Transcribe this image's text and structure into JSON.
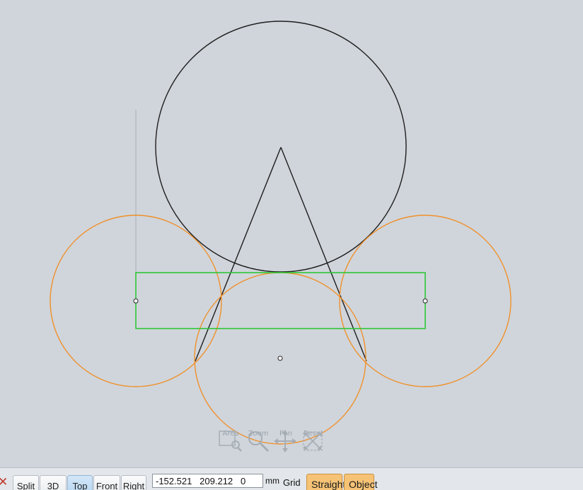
{
  "nav_tools": [
    {
      "label": "Area",
      "icon": "area-zoom-icon"
    },
    {
      "label": "Zoom",
      "icon": "zoom-icon"
    },
    {
      "label": "Pan",
      "icon": "pan-icon"
    },
    {
      "label": "Reset",
      "icon": "reset-view-icon"
    }
  ],
  "toolbar": {
    "close_glyph": "✕",
    "views": [
      "Split",
      "3D",
      "Top",
      "Front",
      "Right"
    ],
    "active_view": "Top",
    "coordinates": "-152.521   209.212   0",
    "unit": "mm",
    "grid_label": "Grid",
    "straight_label": "Straight",
    "object_label": "Object"
  },
  "colors": {
    "background": "#d0d5db",
    "sketch_line": "#1e1e1e",
    "selected_circle": "#f0902a",
    "selected_rect": "#2ec838",
    "construction_line": "#a9afb6",
    "mode_button": "#f6c376"
  }
}
